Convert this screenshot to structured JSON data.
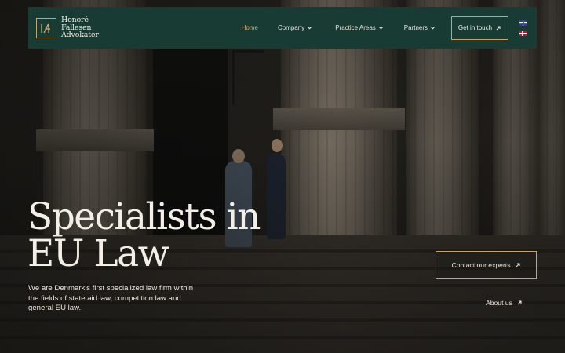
{
  "brand": {
    "logo_mark": "IA",
    "name_lines": [
      "Honoré",
      "Fallesen",
      "Advokater"
    ],
    "accent_color": "#c7a46a",
    "nav_background": "#183c34"
  },
  "nav": {
    "home": "Home",
    "company": "Company",
    "practice_areas": "Practice Areas",
    "partners": "Partners",
    "get_in_touch": "Get in touch",
    "languages": [
      "english-flag-icon",
      "danish-flag-icon"
    ]
  },
  "hero": {
    "title_line1": "Specialists in",
    "title_line2": "EU Law",
    "description": "We are Denmark's first specialized law firm within the fields of state aid law, competition law and general EU law.",
    "cta_contact": "Contact our experts",
    "about_link": "About us"
  }
}
